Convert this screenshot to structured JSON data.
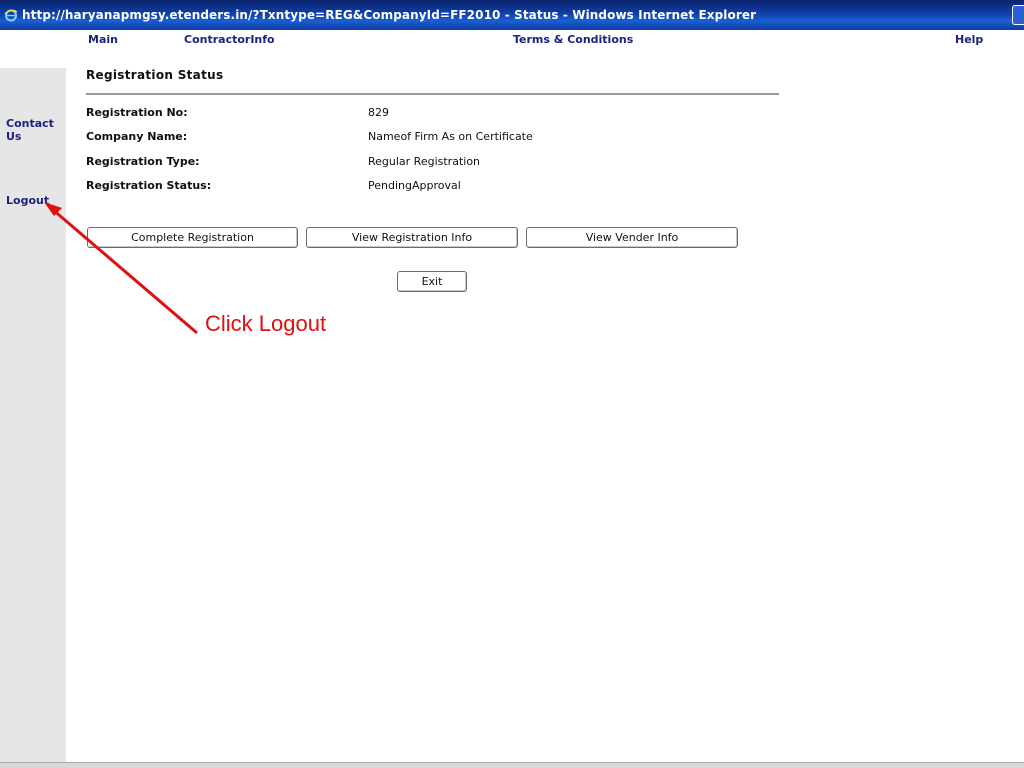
{
  "window": {
    "title": "http://haryanapmgsy.etenders.in/?Txntype=REG&CompanyId=FF2010 - Status - Windows Internet Explorer",
    "icon": "ie-icon"
  },
  "topnav": {
    "items": [
      {
        "label": "Main"
      },
      {
        "label": "ContractorInfo"
      },
      {
        "label": "Terms & Conditions"
      },
      {
        "label": "Help"
      }
    ]
  },
  "sidebar": {
    "contact_line1": "Contact",
    "contact_line2": "Us",
    "logout": "Logout"
  },
  "main": {
    "title": "Registration Status",
    "rows": [
      {
        "label": "Registration No:",
        "value": "829"
      },
      {
        "label": "Company Name:",
        "value": "Nameof Firm As on Certificate"
      },
      {
        "label": "Registration Type:",
        "value": "Regular Registration"
      },
      {
        "label": "Registration Status:",
        "value": "PendingApproval"
      }
    ],
    "buttons": {
      "complete": "Complete Registration",
      "view_reg": "View Registration Info",
      "view_vendor": "View Vender Info",
      "exit": "Exit"
    }
  },
  "annotation": {
    "text": "Click Logout",
    "color": "#e01010"
  },
  "colors": {
    "nav_link": "#1a237e",
    "sidebar_bg": "#e6e6e6",
    "titlebar": "#0f3fa8"
  }
}
